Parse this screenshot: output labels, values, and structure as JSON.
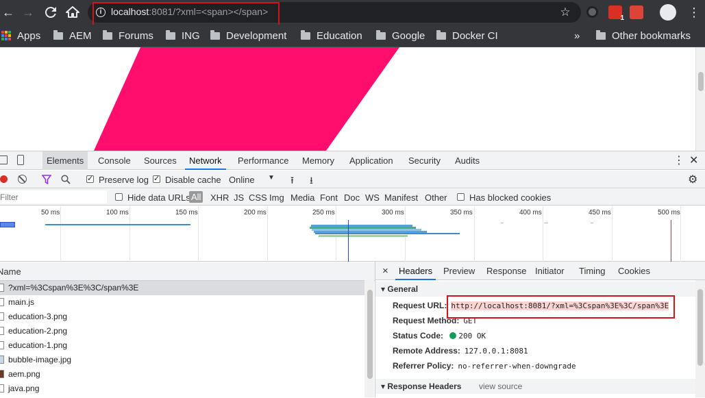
{
  "browser": {
    "url_host": "localhost",
    "url_rest": ":8081/?xml=<span></span>",
    "bookmarks": [
      "Apps",
      "AEM",
      "Forums",
      "ING",
      "Development",
      "Education",
      "Google",
      "Docker CI"
    ],
    "overflow": "»",
    "other_bookmarks": "Other bookmarks",
    "extension_badge": "1"
  },
  "devtools": {
    "tabs": [
      "Elements",
      "Console",
      "Sources",
      "Network",
      "Performance",
      "Memory",
      "Application",
      "Security",
      "Audits"
    ],
    "active_tab": "Network",
    "toolbar": {
      "preserve_log": "Preserve log",
      "disable_cache": "Disable cache",
      "throttle": "Online"
    },
    "filter": {
      "placeholder": "Filter",
      "hide_data_urls": "Hide data URLs",
      "types": [
        "All",
        "XHR",
        "JS",
        "CSS",
        "Img",
        "Media",
        "Font",
        "Doc",
        "WS",
        "Manifest",
        "Other"
      ],
      "has_blocked_cookies": "Has blocked cookies"
    },
    "timeline_ticks": [
      "50 ms",
      "100 ms",
      "150 ms",
      "200 ms",
      "250 ms",
      "300 ms",
      "350 ms",
      "400 ms",
      "450 ms",
      "500 ms"
    ],
    "name_column": "Name",
    "requests": [
      "?xml=%3Cspan%3E%3C/span%3E",
      "main.js",
      "education-3.png",
      "education-2.png",
      "education-1.png",
      "bubble-image.jpg",
      "aem.png",
      "java.png"
    ],
    "details": {
      "close": "×",
      "tabs": [
        "Headers",
        "Preview",
        "Response",
        "Initiator",
        "Timing",
        "Cookies"
      ],
      "general_title": "General",
      "general": [
        {
          "key": "Request URL:",
          "value": "http://localhost:8081/?xml=%3Cspan%3E%3C/span%3E"
        },
        {
          "key": "Request Method:",
          "value": "GET"
        },
        {
          "key": "Status Code:",
          "value": "200 OK"
        },
        {
          "key": "Remote Address:",
          "value": "127.0.0.1:8081"
        },
        {
          "key": "Referrer Policy:",
          "value": "no-referrer-when-downgrade"
        }
      ],
      "response_headers_title": "Response Headers",
      "view_source": "view source"
    }
  }
}
